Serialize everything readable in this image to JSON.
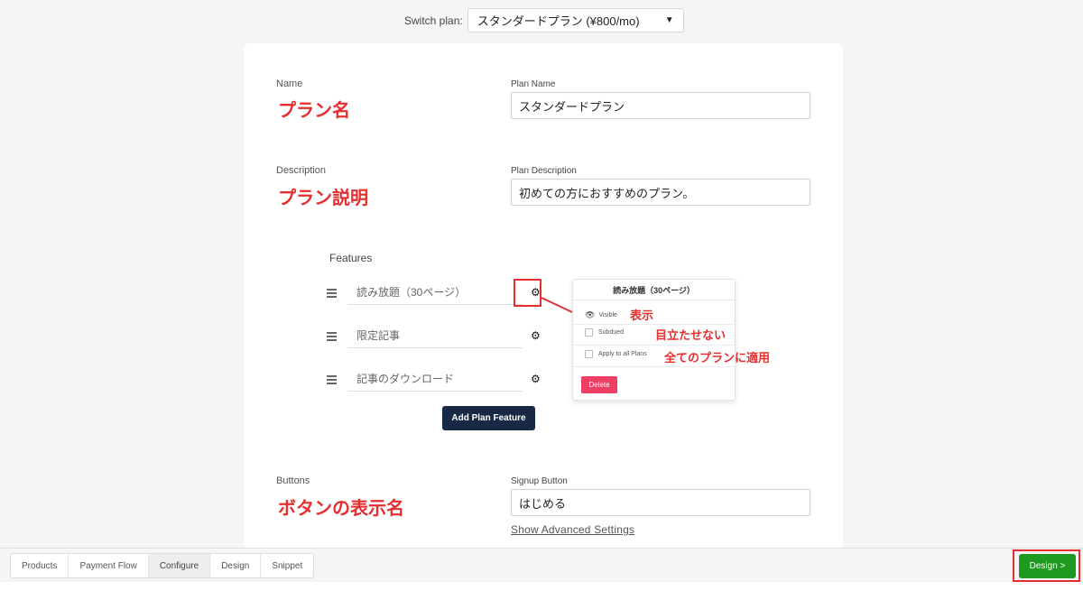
{
  "switch_plan": {
    "label": "Switch plan:",
    "selected": "スタンダードプラン (¥800/mo)"
  },
  "name_section": {
    "label": "Name",
    "annotation": "プラン名",
    "field_label": "Plan Name",
    "value": "スタンダードプラン"
  },
  "description_section": {
    "label": "Description",
    "annotation": "プラン説明",
    "field_label": "Plan Description",
    "value": "初めての方におすすめのプラン。"
  },
  "features": {
    "title": "Features",
    "items": [
      {
        "label": "読み放題（30ページ）"
      },
      {
        "label": "限定記事"
      },
      {
        "label": "記事のダウンロード"
      }
    ],
    "add_button": "Add Plan Feature"
  },
  "feature_popup": {
    "title": "読み放題（30ページ）",
    "visible_label": "Visible",
    "subdued_label": "Subdued",
    "apply_all_label": "Apply to all Plans",
    "delete_label": "Delete",
    "annotations": {
      "visible": "表示",
      "subdued": "目立たせない",
      "apply_all": "全てのプランに適用"
    }
  },
  "buttons_section": {
    "label": "Buttons",
    "annotation": "ボタンの表示名",
    "field_label": "Signup Button",
    "value": "はじめる",
    "advanced_link": "Show Advanced Settings"
  },
  "bottom_tabs": [
    {
      "label": "Products"
    },
    {
      "label": "Payment Flow"
    },
    {
      "label": "Configure"
    },
    {
      "label": "Design"
    },
    {
      "label": "Snippet"
    }
  ],
  "next_button": "Design >",
  "colors": {
    "annotation_red": "#e62e2e",
    "primary_dark": "#172945",
    "success_green": "#209920",
    "delete_pink": "#ee3e63"
  }
}
